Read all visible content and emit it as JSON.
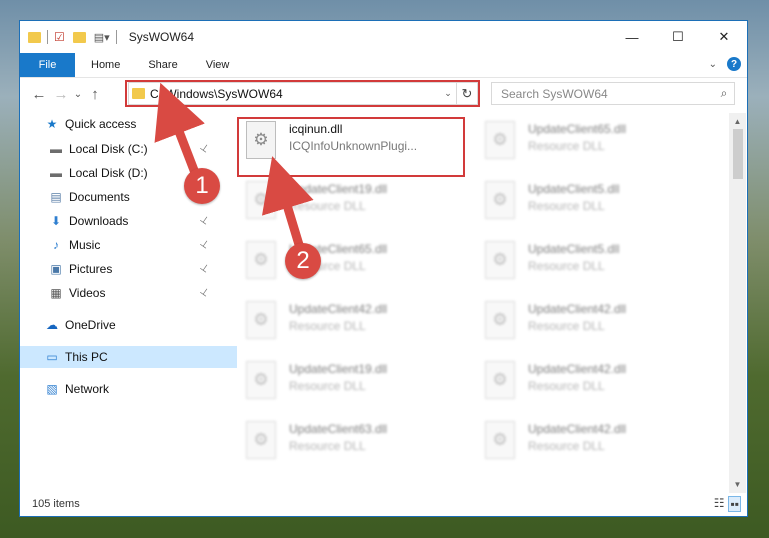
{
  "window": {
    "title": "SysWOW64",
    "controls": {
      "minimize": "—",
      "maximize": "☐",
      "close": "✕"
    }
  },
  "ribbon": {
    "tabs": [
      "File",
      "Home",
      "Share",
      "View"
    ],
    "expand": "⌄",
    "help": "?"
  },
  "nav": {
    "back": "←",
    "forward": "→",
    "recent": "⌄",
    "up": "↑",
    "address": "C:\\Windows\\SysWOW64",
    "dropdown": "⌄",
    "refresh": "↻",
    "search_placeholder": "Search SysWOW64"
  },
  "sidebar": {
    "items": [
      {
        "label": "Quick access",
        "icon": "star-icon",
        "glyph": "★",
        "color": "#1979ca"
      },
      {
        "label": "Local Disk (C:)",
        "icon": "drive-icon",
        "glyph": "▬",
        "color": "#6d6d6d",
        "pinned": true
      },
      {
        "label": "Local Disk (D:)",
        "icon": "drive-icon",
        "glyph": "▬",
        "color": "#6d6d6d",
        "pinned": true
      },
      {
        "label": "Documents",
        "icon": "documents-icon",
        "glyph": "▤",
        "color": "#5b7fa8",
        "pinned": true
      },
      {
        "label": "Downloads",
        "icon": "download-icon",
        "glyph": "⬇",
        "color": "#2f7fd0",
        "pinned": true
      },
      {
        "label": "Music",
        "icon": "music-icon",
        "glyph": "♪",
        "color": "#2f7fd0",
        "pinned": true
      },
      {
        "label": "Pictures",
        "icon": "pictures-icon",
        "glyph": "▣",
        "color": "#4a78a8",
        "pinned": true
      },
      {
        "label": "Videos",
        "icon": "videos-icon",
        "glyph": "▦",
        "color": "#555555",
        "pinned": true
      },
      {
        "label": "OneDrive",
        "icon": "cloud-icon",
        "glyph": "☁",
        "color": "#1565c0"
      },
      {
        "label": "This PC",
        "icon": "computer-icon",
        "glyph": "▭",
        "color": "#2f7fd0",
        "selected": true
      },
      {
        "label": "Network",
        "icon": "network-icon",
        "glyph": "▧",
        "color": "#2f7fd0"
      }
    ],
    "pin_glyph": "📌"
  },
  "files": [
    {
      "name": "icqinun.dll",
      "desc": "ICQInfoUnknownPlugi...",
      "highlight": true
    },
    {
      "name": "UpdateClient65.dll",
      "desc": "Resource DLL"
    },
    {
      "name": "UpdateClient19.dll",
      "desc": "Resource DLL"
    },
    {
      "name": "UpdateClient5.dll",
      "desc": "Resource DLL"
    },
    {
      "name": "UpdateClient65.dll",
      "desc": "Resource DLL"
    },
    {
      "name": "UpdateClient5.dll",
      "desc": "Resource DLL"
    },
    {
      "name": "UpdateClient42.dll",
      "desc": "Resource DLL"
    },
    {
      "name": "UpdateClient42.dll",
      "desc": "Resource DLL"
    },
    {
      "name": "UpdateClient19.dll",
      "desc": "Resource DLL"
    },
    {
      "name": "UpdateClient42.dll",
      "desc": "Resource DLL"
    },
    {
      "name": "UpdateClient63.dll",
      "desc": "Resource DLL"
    },
    {
      "name": "UpdateClient42.dll",
      "desc": "Resource DLL"
    }
  ],
  "status": {
    "items": "105 items"
  },
  "annotations": {
    "badge1": "1",
    "badge2": "2",
    "color": "#d94a43"
  }
}
